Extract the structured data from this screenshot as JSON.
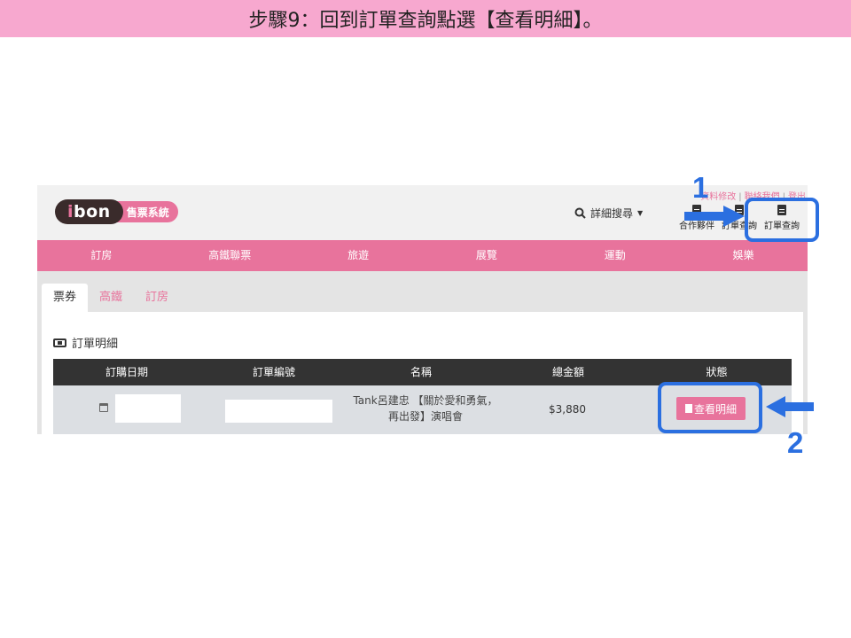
{
  "slide": {
    "title": "步驟9：回到訂單查詢點選【查看明細】。"
  },
  "header": {
    "logo_text": "bon",
    "logo_i": "i",
    "logo_tag": "售票系統",
    "search_label": "詳細搜尋",
    "search_caret": "▼",
    "links": [
      "資料修改",
      "聯絡我們",
      "登出"
    ],
    "icons": [
      {
        "label": "合作夥伴",
        "icon": "camera-icon"
      },
      {
        "label": "訂單查詢",
        "icon": "document-icon"
      },
      {
        "label": "訂單查詢",
        "icon": "document-icon"
      }
    ]
  },
  "nav": [
    "訂房",
    "高鐵聯票",
    "旅遊",
    "展覽",
    "運動",
    "娛樂"
  ],
  "tabs": [
    {
      "label": "票券",
      "active": true
    },
    {
      "label": "高鐵",
      "active": false
    },
    {
      "label": "訂房",
      "active": false
    }
  ],
  "section_title": "訂單明細",
  "table": {
    "headers": [
      "訂購日期",
      "訂單編號",
      "名稱",
      "總金額",
      "狀態"
    ],
    "row": {
      "name": "Tank呂建忠 【關於愛和勇氣，再出發】演唱會",
      "amount": "$3,880",
      "button": "查看明細"
    }
  },
  "annotations": {
    "step1": "1",
    "step2": "2",
    "color": "#2b6fe0"
  },
  "colors": {
    "brand_pink": "#e8739c",
    "title_bar": "#f7a8cf",
    "dark": "#333333"
  }
}
